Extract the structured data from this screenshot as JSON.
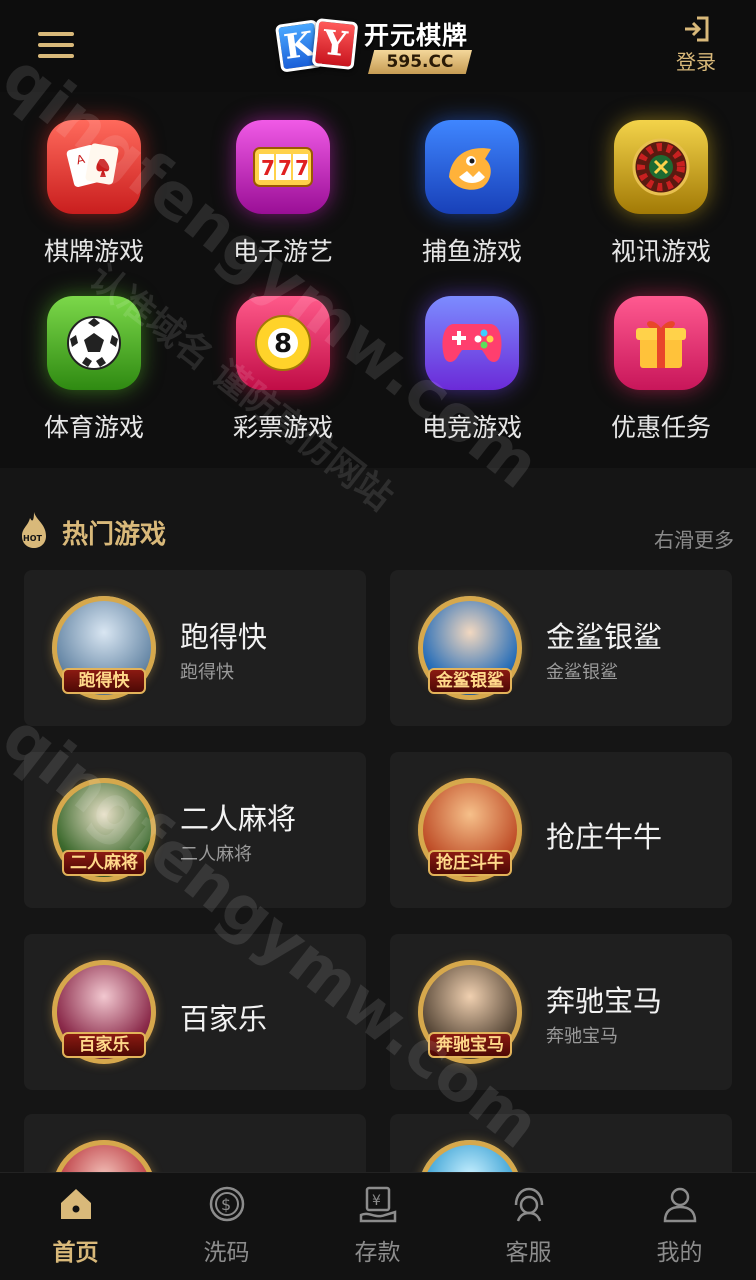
{
  "header": {
    "logo_letters": [
      "K",
      "Y"
    ],
    "brand": "开元棋牌",
    "site": "595.CC",
    "login_label": "登录",
    "menu_icon": "hamburger-icon",
    "login_icon": "login-icon"
  },
  "categories": [
    {
      "label": "棋牌游戏",
      "icon": "playing-cards-icon",
      "color": "#e0352c"
    },
    {
      "label": "电子游艺",
      "icon": "slot-777-icon",
      "color": "#c61fb8"
    },
    {
      "label": "捕鱼游戏",
      "icon": "shark-icon",
      "color": "#1f5fe0"
    },
    {
      "label": "视讯游戏",
      "icon": "roulette-icon",
      "color": "#c9a21a"
    },
    {
      "label": "体育游戏",
      "icon": "soccer-ball-icon",
      "color": "#4bb524"
    },
    {
      "label": "彩票游戏",
      "icon": "billiard-8-ball-icon",
      "color": "#e0215f"
    },
    {
      "label": "电竞游戏",
      "icon": "gamepad-icon",
      "color": "#7a3df0"
    },
    {
      "label": "优惠任务",
      "icon": "gift-icon",
      "color": "#e8336e"
    }
  ],
  "hot": {
    "title": "热门游戏",
    "more": "右滑更多",
    "badge": "HOT"
  },
  "games": [
    {
      "name": "跑得快",
      "sub": "跑得快",
      "tag": "跑得快",
      "color": "#6a8aa8"
    },
    {
      "name": "金鲨银鲨",
      "sub": "金鲨银鲨",
      "tag": "金鲨银鲨",
      "color": "#2a6fb8"
    },
    {
      "name": "二人麻将",
      "sub": "二人麻将",
      "tag": "二人麻将",
      "color": "#3d6a2e"
    },
    {
      "name": "抢庄牛牛",
      "sub": "",
      "tag": "抢庄斗牛",
      "color": "#c0502a"
    },
    {
      "name": "百家乐",
      "sub": "",
      "tag": "百家乐",
      "color": "#8a2a4a"
    },
    {
      "name": "奔驰宝马",
      "sub": "奔驰宝马",
      "tag": "奔驰宝马",
      "color": "#5a4a3a"
    },
    {
      "name": "",
      "sub": "",
      "tag": "",
      "color": "#b8323a"
    },
    {
      "name": "",
      "sub": "",
      "tag": "",
      "color": "#2e9ad0"
    }
  ],
  "watermark": {
    "domain": "qingfengymw.com",
    "slogan": "认准域名 谨防高仿网站"
  },
  "nav": [
    {
      "label": "首页",
      "icon": "home-icon",
      "active": true
    },
    {
      "label": "洗码",
      "icon": "coin-icon",
      "active": false
    },
    {
      "label": "存款",
      "icon": "deposit-icon",
      "active": false
    },
    {
      "label": "客服",
      "icon": "customer-service-icon",
      "active": false
    },
    {
      "label": "我的",
      "icon": "user-icon",
      "active": false
    }
  ]
}
